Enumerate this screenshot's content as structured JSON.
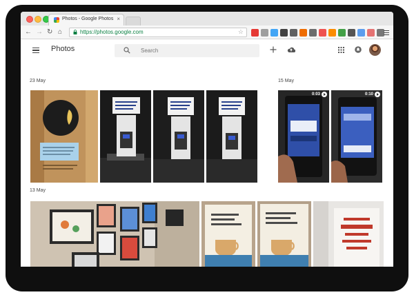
{
  "browser": {
    "tab_title": "Photos - Google Photos",
    "tab_close": "×",
    "nav_back": "←",
    "nav_forward": "→",
    "nav_reload": "↻",
    "nav_home": "⌂",
    "address": "https://photos.google.com",
    "bookmark_star": "☆",
    "extensions": [
      {
        "name": "puzzle-extension-icon",
        "color": "#e53935"
      },
      {
        "name": "cast-extension-icon",
        "color": "#9e9e9e"
      },
      {
        "name": "camera-extension-icon",
        "color": "#42a5f5"
      },
      {
        "name": "dark-extension-icon",
        "color": "#424242"
      },
      {
        "name": "wallet-extension-icon",
        "color": "#616161"
      },
      {
        "name": "opera-extension-icon",
        "color": "#ef6c00"
      },
      {
        "name": "lightning-extension-icon",
        "color": "#6d6d6d"
      },
      {
        "name": "pocket-extension-icon",
        "color": "#ef5350"
      },
      {
        "name": "shield-extension-icon",
        "color": "#fb8c00"
      },
      {
        "name": "tasks-extension-icon",
        "color": "#43a047"
      },
      {
        "name": "at-extension-icon",
        "color": "#555555"
      },
      {
        "name": "user-extension-icon",
        "color": "#5c9ded"
      },
      {
        "name": "mail-extension-icon",
        "color": "#e57373"
      },
      {
        "name": "more-extension-icon",
        "color": "#777777"
      }
    ]
  },
  "app": {
    "title": "Photos",
    "search_placeholder": "Search"
  },
  "sections": [
    {
      "label": "23 May"
    },
    {
      "label": "15 May"
    },
    {
      "label": "13 May"
    }
  ],
  "videos": [
    {
      "duration": "0:03"
    },
    {
      "duration": "0:10"
    }
  ],
  "colors": {
    "accent_green": "#0b8043",
    "header_text": "#333333"
  }
}
